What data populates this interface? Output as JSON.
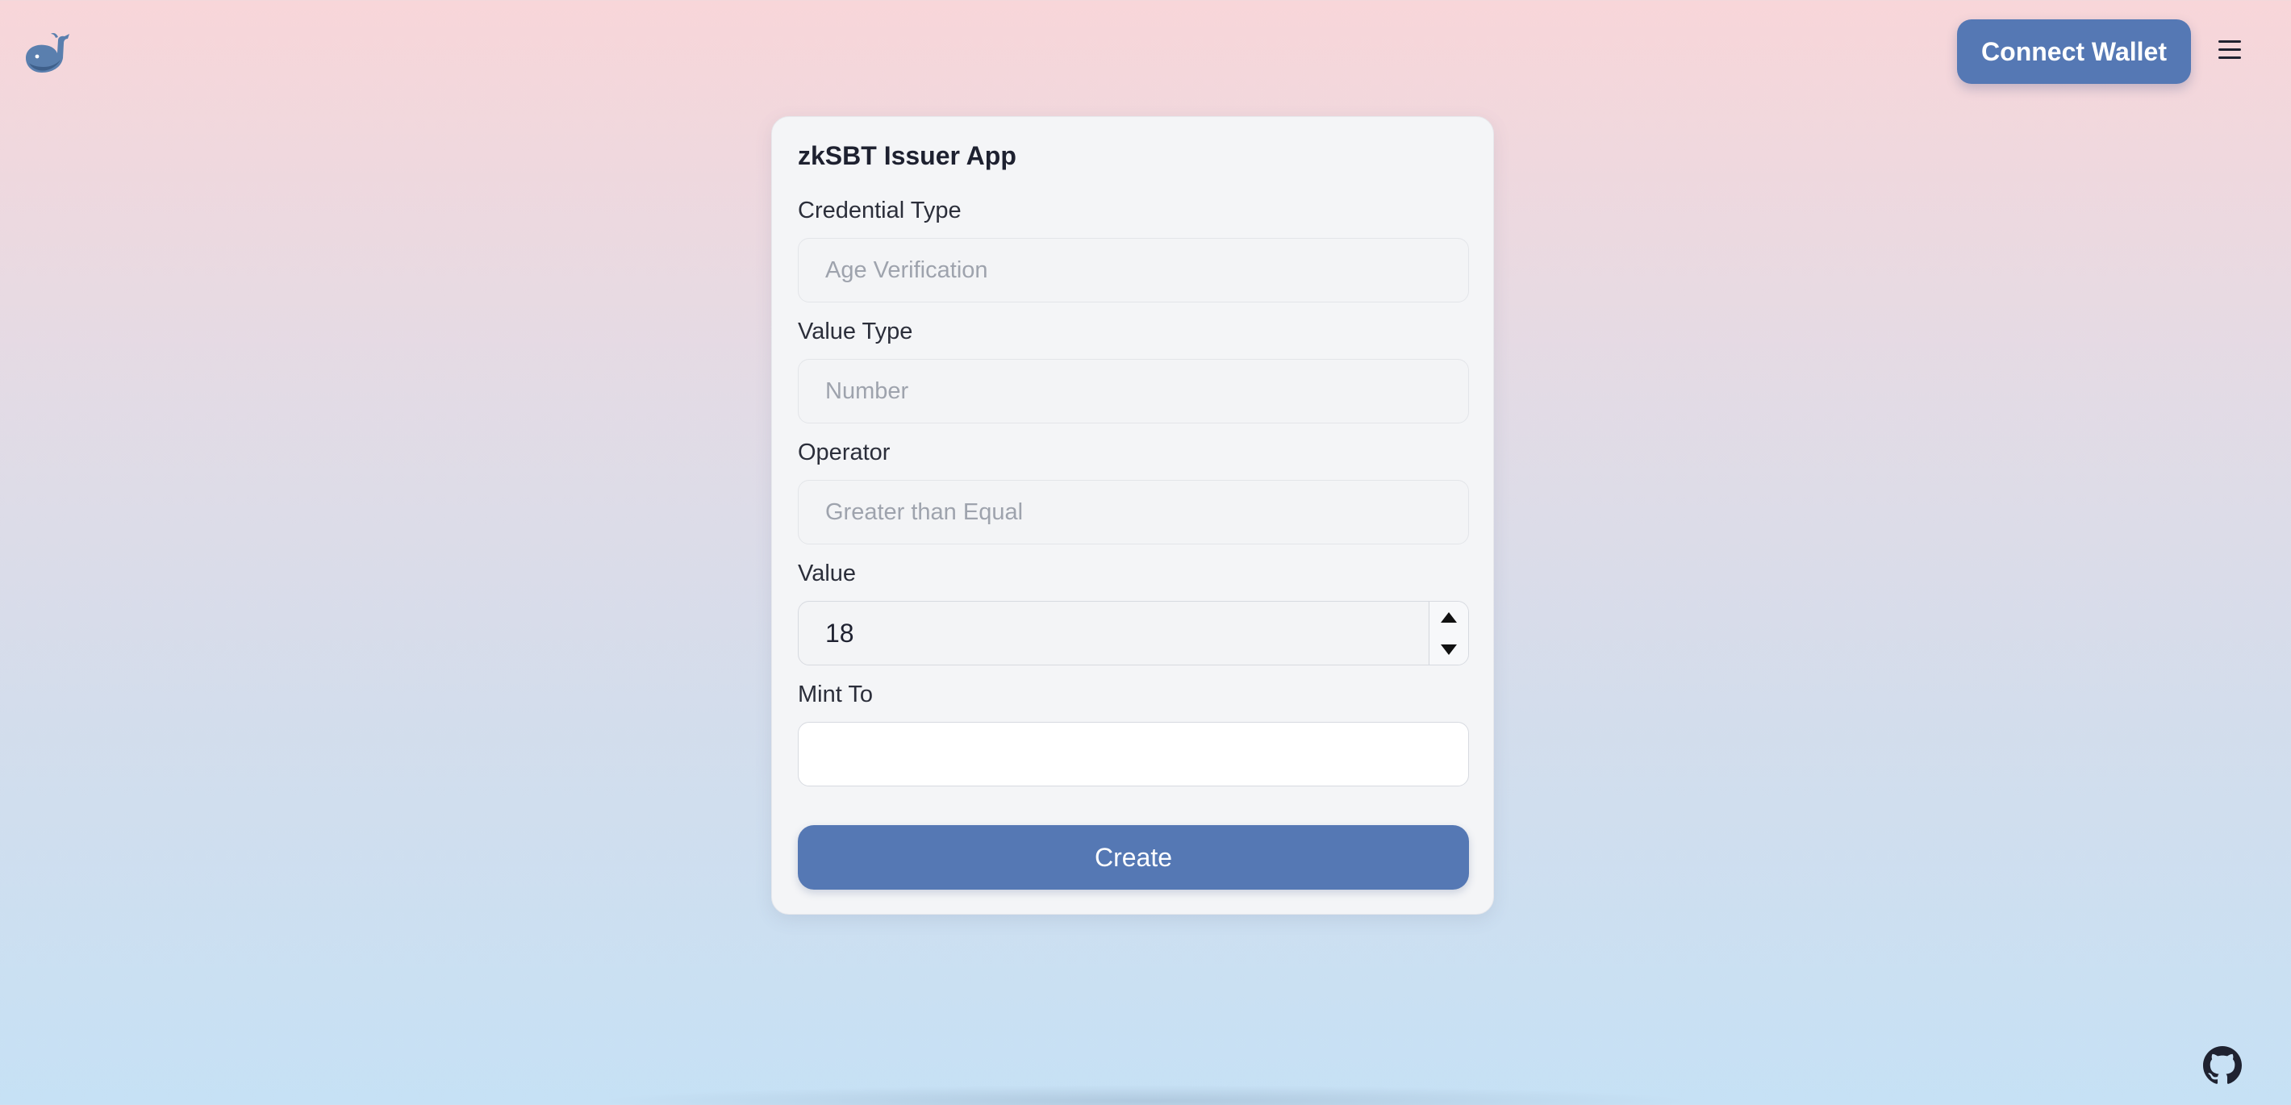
{
  "header": {
    "logo_icon": "whale-icon",
    "connect_label": "Connect Wallet",
    "menu_icon": "hamburger-menu-icon"
  },
  "form": {
    "title": "zkSBT Issuer App",
    "credential_type": {
      "label": "Credential Type",
      "value": "",
      "placeholder": "Age Verification"
    },
    "value_type": {
      "label": "Value Type",
      "value": "",
      "placeholder": "Number"
    },
    "operator": {
      "label": "Operator",
      "value": "",
      "placeholder": "Greater than Equal"
    },
    "value": {
      "label": "Value",
      "value": "18"
    },
    "mint_to": {
      "label": "Mint To",
      "value": "",
      "placeholder": ""
    },
    "submit_label": "Create"
  },
  "footer": {
    "github_icon": "github-icon"
  },
  "colors": {
    "accent": "#5578b4",
    "background_top": "#f8d6d9",
    "background_bottom": "#c6e1f5",
    "card": "#f4f5f7"
  }
}
